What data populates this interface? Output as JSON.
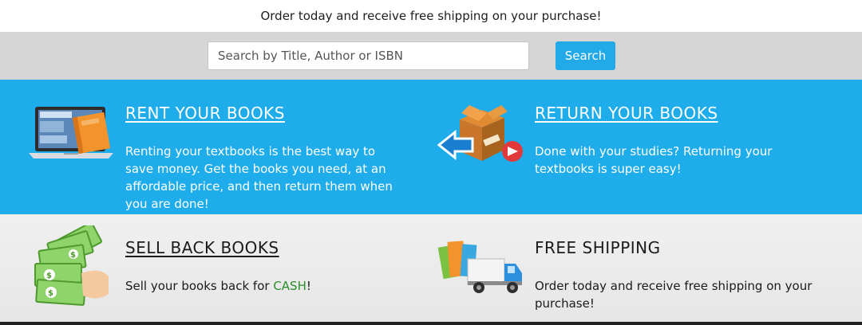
{
  "banner": {
    "text": "Order today and receive free shipping on your purchase!"
  },
  "search": {
    "placeholder": "Search by Title, Author or ISBN",
    "button_label": "Search"
  },
  "features": {
    "rent": {
      "title": "RENT YOUR BOOKS",
      "text": "Renting your textbooks is the best way to save money. Get the books you need, at an affordable price, and then return them when you are done!",
      "icon": "laptop-book-icon"
    },
    "return": {
      "title": "RETURN YOUR BOOKS",
      "text": "Done with your studies? Returning your textbooks is super easy!",
      "icon": "return-box-icon"
    },
    "sell": {
      "title": "SELL BACK BOOKS",
      "text_before": "Sell your books back for ",
      "text_highlight": "CASH",
      "text_after": "!",
      "icon": "cash-money-icon"
    },
    "shipping": {
      "title": "FREE SHIPPING",
      "text": "Order today and receive free shipping on your purchase!",
      "icon": "delivery-truck-icon"
    }
  },
  "colors": {
    "blue_band": "#1eaceb",
    "button": "#22a9e8",
    "cash_green": "#2a8f2a"
  }
}
